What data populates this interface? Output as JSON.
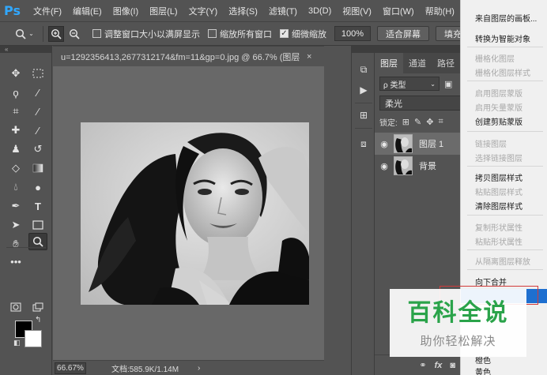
{
  "app": {
    "logo": "Ps"
  },
  "menubar": [
    "文件(F)",
    "编辑(E)",
    "图像(I)",
    "图层(L)",
    "文字(Y)",
    "选择(S)",
    "滤镜(T)",
    "3D(D)",
    "视图(V)",
    "窗口(W)",
    "帮助(H)"
  ],
  "options": {
    "resize_windows": "调整窗口大小以满屏显示",
    "zoom_all": "缩放所有窗口",
    "scrubby_zoom": "细微缩放",
    "zoom_value": "100%",
    "fit_screen": "适合屏幕",
    "fill_screen": "填充"
  },
  "document": {
    "tab_title": "u=1292356413,2677312174&fm=11&gp=0.jpg @ 66.7% (图层 ...",
    "close": "×"
  },
  "status": {
    "zoom": "66.67%",
    "doc_info": "文档:585.9K/1.14M",
    "arrow": "›"
  },
  "layers_panel": {
    "tabs": [
      "图层",
      "通道",
      "路径"
    ],
    "filter_kind": "ρ 类型",
    "blend_mode": "柔光",
    "lock_label": "锁定:",
    "layers": [
      {
        "name": "图层 1",
        "selected": true
      },
      {
        "name": "背景",
        "selected": false
      }
    ],
    "bottom_fx": "fx"
  },
  "context_menu": {
    "items": [
      {
        "label": "来自图层的画板...",
        "disabled": false
      },
      {
        "label": "转换为智能对象",
        "disabled": false
      },
      {
        "label": "栅格化图层",
        "disabled": true
      },
      {
        "label": "栅格化图层样式",
        "disabled": true
      },
      {
        "label": "启用图层蒙版",
        "disabled": true
      },
      {
        "label": "启用矢量蒙版",
        "disabled": true
      },
      {
        "label": "创建剪贴蒙版",
        "disabled": false
      },
      {
        "label": "链接图层",
        "disabled": true
      },
      {
        "label": "选择链接图层",
        "disabled": true
      },
      {
        "label": "拷贝图层样式",
        "disabled": false
      },
      {
        "label": "粘贴图层样式",
        "disabled": true
      },
      {
        "label": "清除图层样式",
        "disabled": false
      },
      {
        "label": "复制形状属性",
        "disabled": true
      },
      {
        "label": "粘贴形状属性",
        "disabled": true
      },
      {
        "label": "从隔离图层释放",
        "disabled": true
      },
      {
        "label": "向下合并",
        "disabled": false
      },
      {
        "label": "橙色",
        "disabled": false
      },
      {
        "label": "黄色",
        "disabled": false
      }
    ]
  },
  "watermark": {
    "title": "百科全说",
    "subtitle": "助你轻松解决"
  },
  "colors": {
    "accent": "#31a8ff",
    "highlight": "#1e6fd0",
    "outline": "#d23b3b",
    "watermark": "#2aa34a"
  }
}
